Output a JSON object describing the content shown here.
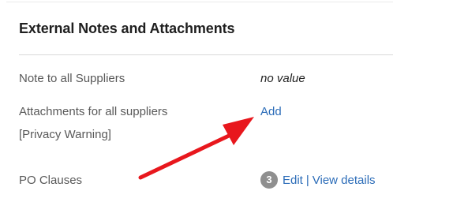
{
  "section": {
    "title": "External Notes and Attachments"
  },
  "rows": {
    "note_to_suppliers": {
      "label": "Note to all Suppliers",
      "value": "no value"
    },
    "attachments": {
      "label_line1": "Attachments for all suppliers",
      "label_line2": "[Privacy Warning]",
      "action": "Add"
    },
    "po_clauses": {
      "label": "PO Clauses",
      "count": "3",
      "edit": "Edit",
      "separator": "|",
      "view_details": "View details"
    }
  },
  "annotation": {
    "arrow_color": "#e8171d"
  }
}
